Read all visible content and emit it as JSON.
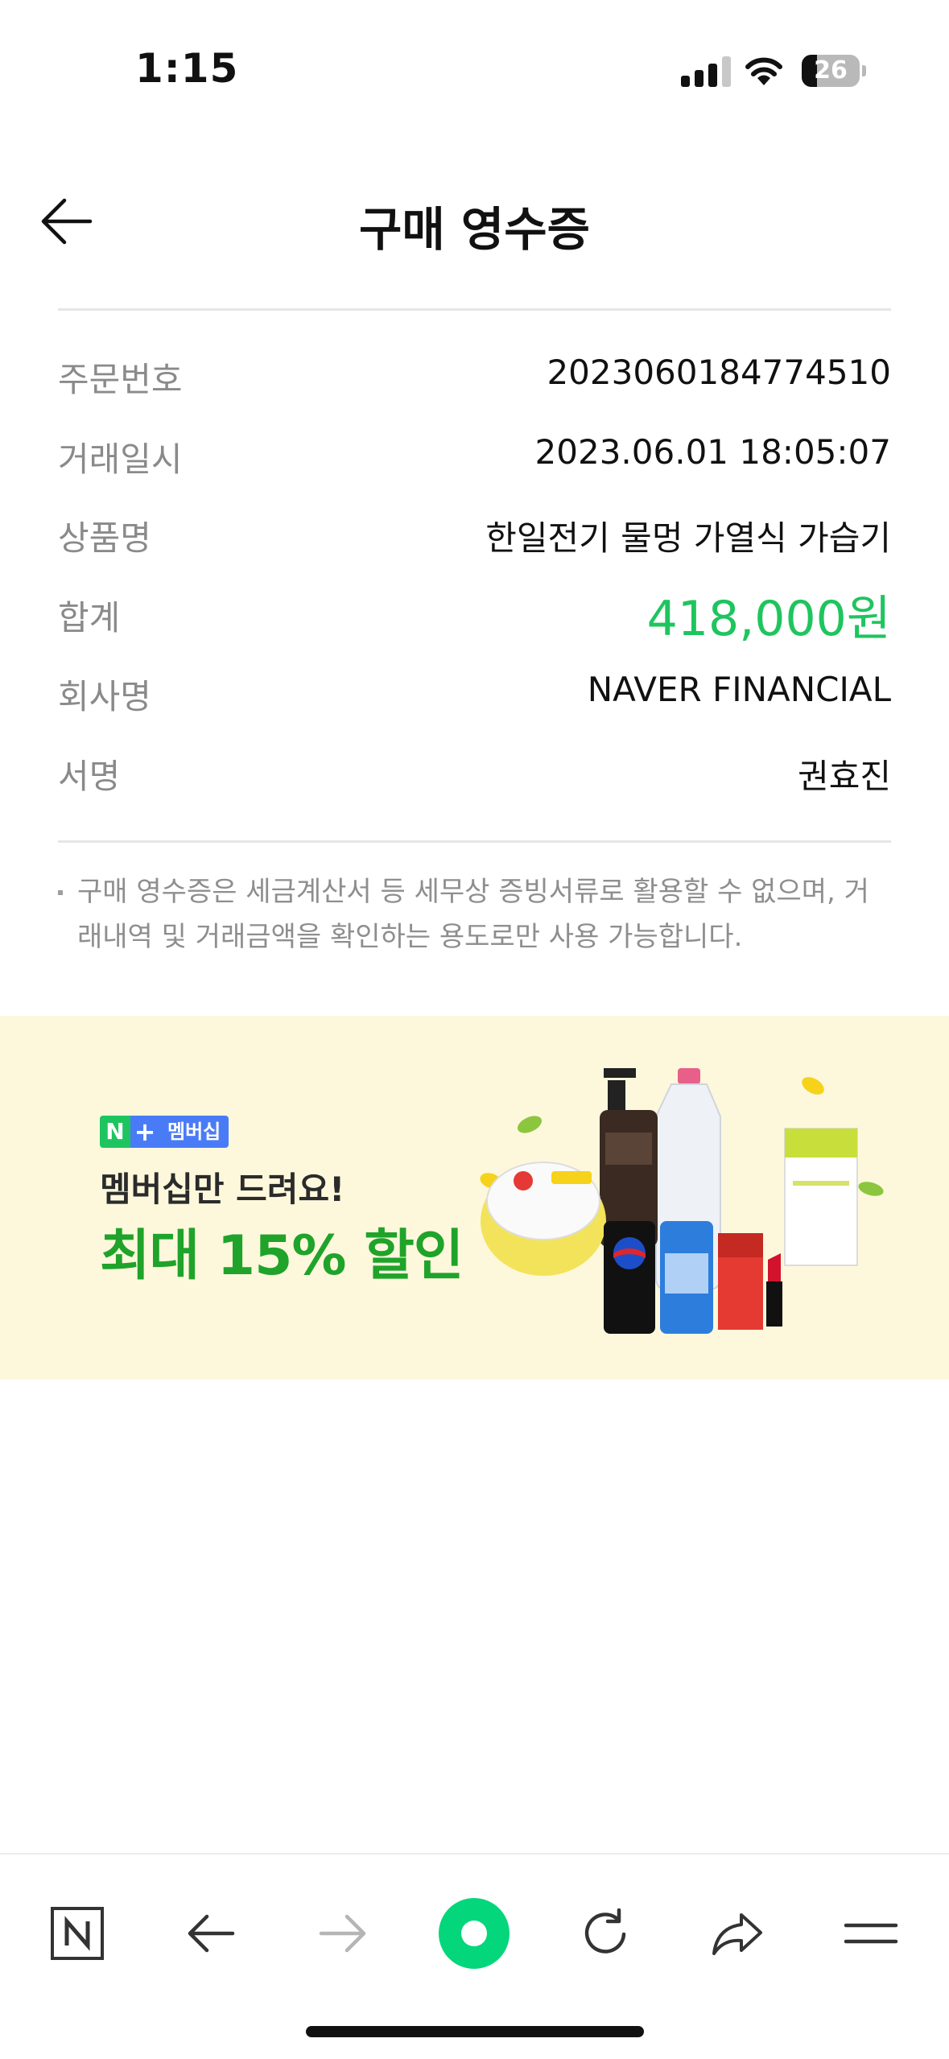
{
  "status_bar": {
    "time": "1:15",
    "battery_level": "26",
    "battery_fraction": 0.26,
    "signal_icon": "cellular-signal-icon",
    "wifi_icon": "wifi-icon"
  },
  "header": {
    "title": "구매 영수증",
    "back_icon": "arrow-left-icon"
  },
  "receipt": {
    "rows": [
      {
        "label": "주문번호",
        "value": "2023060184774510"
      },
      {
        "label": "거래일시",
        "value": "2023.06.01 18:05:07"
      },
      {
        "label": "상품명",
        "value": "한일전기 물멍 가열식 가습기"
      },
      {
        "label": "합계",
        "value": "418,000원"
      },
      {
        "label": "회사명",
        "value": "NAVER FINANCIAL"
      },
      {
        "label": "서명",
        "value": "권효진"
      }
    ],
    "amount_color": "#1ec55e"
  },
  "notice": {
    "text": "구매 영수증은 세금계산서 등 세무상 증빙서류로 활용할 수 없으며, 거래내역 및 거래금액을 확인하는 용도로만 사용 가능합니다."
  },
  "banner": {
    "badge_n": "N",
    "badge_plus": "+",
    "badge_label": "멤버십",
    "subtitle": "멤버십만 드려요!",
    "title": "최대 15% 할인",
    "background_color": "#fdf8dc",
    "accent_color": "#1fa32a",
    "products_image": "grocery-products-image"
  },
  "toolbar": {
    "items": [
      {
        "name": "naver-home-icon"
      },
      {
        "name": "back-arrow-icon"
      },
      {
        "name": "forward-arrow-icon"
      },
      {
        "name": "green-dot-icon"
      },
      {
        "name": "refresh-icon"
      },
      {
        "name": "share-icon"
      },
      {
        "name": "menu-icon"
      }
    ],
    "accent_color": "#03d67b"
  }
}
